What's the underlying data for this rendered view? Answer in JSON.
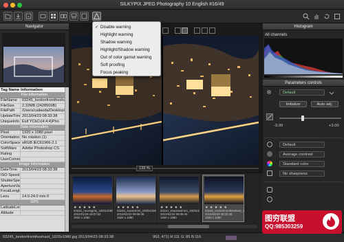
{
  "window": {
    "title": "SILKYPIX JPEG Photography 10 English  #16/49"
  },
  "navigator": {
    "title": "Navigator"
  },
  "info_table": {
    "col_tag": "Tag Name",
    "col_info": "Information",
    "sections": [
      {
        "title": "File information",
        "rows": [
          [
            "FileName",
            "03245_londonfromtheshard"
          ],
          [
            "FileSize",
            "2.32MB (2428509B)"
          ],
          [
            "FilePath",
            "/Users/cailaoda/Desktop/3277"
          ],
          [
            "UpdateTime",
            "2013/04/23 08:33:38"
          ],
          [
            "UniqueInfo",
            "Exif YCbCr(4:4:4)Pho"
          ]
        ]
      },
      {
        "title": "Data information",
        "rows": [
          [
            "Pixel",
            "1920 x 1080 pixel"
          ],
          [
            "Orientation",
            "No rotation (1)"
          ],
          [
            "ColorSpace",
            "sRGB IEC61966-2.1"
          ],
          [
            "SoftWare",
            "Adobe Photoshop CS"
          ],
          [
            "Rating",
            ""
          ],
          [
            "UserComment",
            ""
          ]
        ]
      },
      {
        "title": "Image information",
        "rows": [
          [
            "DateTime",
            "2013/04/23 08:33:38"
          ],
          [
            "ISO Speed",
            ""
          ],
          [
            "ShutterSpeed",
            ""
          ],
          [
            "ApertureVal",
            ""
          ],
          [
            "FocalLength",
            ""
          ],
          [
            "Lens",
            "14.0-24.0 mm f/"
          ]
        ]
      },
      {
        "title": "GPS",
        "rows": [
          [
            "LatitudeLongit",
            ""
          ],
          [
            "Altitude",
            ""
          ]
        ]
      }
    ]
  },
  "warning_menu": {
    "items": [
      {
        "label": "Disable warning",
        "checked": true
      },
      {
        "label": "Highlight warning",
        "checked": false
      },
      {
        "label": "Shadow warning",
        "checked": false
      },
      {
        "label": "Highlight/Shadow warning",
        "checked": false
      },
      {
        "label": "Out of color gamut warning",
        "checked": false
      },
      {
        "label": "Soft proofing",
        "checked": false
      },
      {
        "label": "Focus peaking",
        "checked": false
      }
    ]
  },
  "viewer": {
    "zoom": "133 %"
  },
  "filmstrip": {
    "thumbs": [
      {
        "stars": "★ ★ ★ ★ ★",
        "name": "03242_neonlights_1920x1080.jpg",
        "date": "2012/01/26 18:07:52",
        "size": "1920 x 1080",
        "selected": false,
        "palette": [
          "#0b1a3a",
          "#2b4a8c",
          "#c86a2a"
        ]
      },
      {
        "stars": "★ ★ ★ ★ ★",
        "name": "03243_sunsetrom_1920x1080.jpg",
        "date": "2013/02/22 08:06:38",
        "size": "1920 x 1080",
        "selected": false,
        "palette": [
          "#1a2a4a",
          "#8a9ac8",
          "#e8c08a"
        ]
      },
      {
        "stars": "★ ★ ★ ★ ★",
        "name": "03244_shadowsfrom_1920x1080.jpg",
        "date": "2013/02/22 08:06:40",
        "size": "1920 x 1080",
        "selected": false,
        "palette": [
          "#101828",
          "#3a4a6a",
          "#d89a4a"
        ]
      },
      {
        "stars": "★ ★ ★ ★ ★",
        "name": "03245_londonfromtheshard_1920x1080.jpg",
        "date": "2013/04/23 08:33:38",
        "size": "1920 x 1080",
        "selected": true,
        "palette": [
          "#0d1020",
          "#2a3a5a",
          "#e0a040"
        ]
      }
    ]
  },
  "histogram": {
    "title": "Histogram",
    "channel": "All channels"
  },
  "params": {
    "title": "Parameters controls",
    "preset": "Default",
    "initialize": "Initialize",
    "auto_adj": "Auto adj.",
    "exposure_min": "-3.00",
    "exposure_max": "+3.00",
    "exposure_value": 0.38,
    "dd_default": "Default",
    "dd_contrast": "Average contrast",
    "dd_color": "Standard color",
    "dd_sharpness": "No sharpness"
  },
  "status": {
    "file": "03245_londonfromtheshard_1920x1080.jpg  2013/04/23 08:33:38",
    "pixel": "952, 471) R:111 G: 85 B:116"
  },
  "watermark": {
    "line1": "图穷联盟",
    "line2": "QQ:985303259"
  },
  "colors": {
    "accent": "#3b7be0",
    "menu_bg": "#ececec",
    "panel_bg": "#262626",
    "watermark": "#c8102e"
  }
}
